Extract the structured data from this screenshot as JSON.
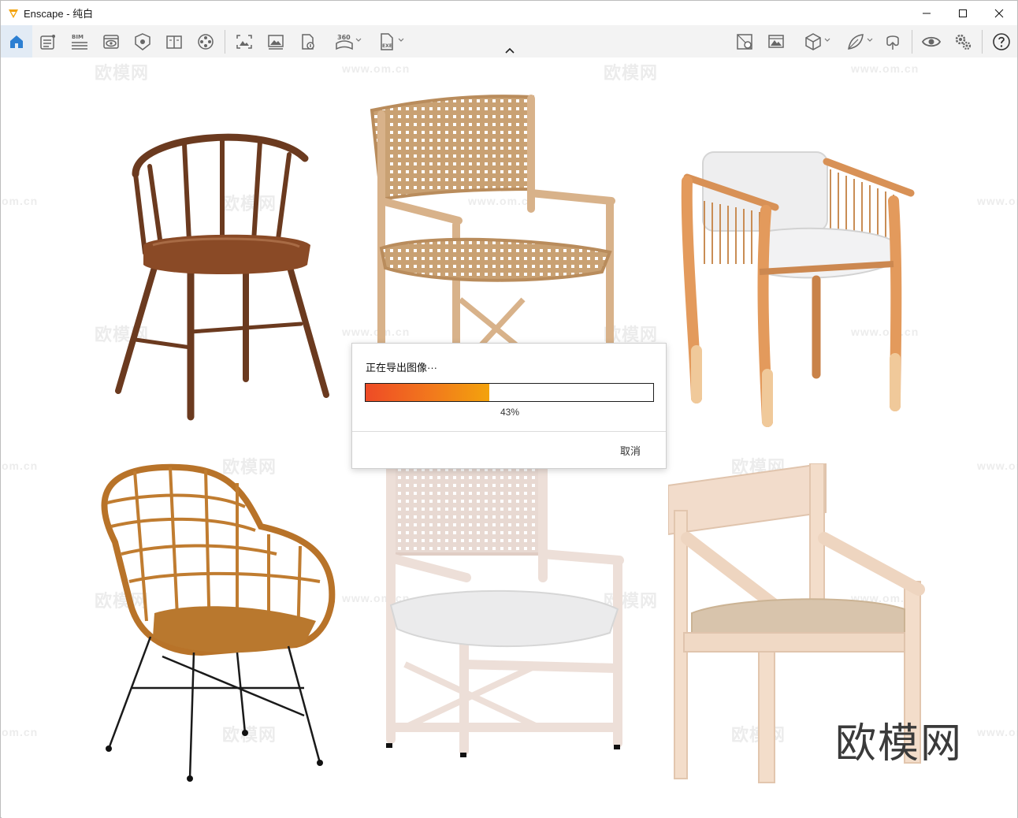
{
  "window": {
    "title": "Enscape - 纯白",
    "accent_color": "#f3a30c"
  },
  "toolbar": {
    "items": [
      {
        "name": "home-icon",
        "active": true
      },
      {
        "name": "asset-library-icon"
      },
      {
        "name": "bim-icon",
        "label": "BIM"
      },
      {
        "name": "view-icon"
      },
      {
        "name": "material-icon"
      },
      {
        "name": "book-icon"
      },
      {
        "name": "film-reel-icon"
      },
      {
        "name": "screenshot-icon"
      },
      {
        "name": "batch-render-icon"
      },
      {
        "name": "upload-icon"
      },
      {
        "name": "panorama-360-icon",
        "label": "360"
      },
      {
        "name": "export-exe-icon",
        "label": "EXE"
      },
      {
        "name": "cube-map-icon"
      },
      {
        "name": "image-gallery-icon"
      },
      {
        "name": "cube-icon"
      },
      {
        "name": "leaf-icon"
      },
      {
        "name": "vr-headset-icon"
      },
      {
        "name": "eye-icon"
      },
      {
        "name": "settings-icon"
      },
      {
        "name": "help-icon"
      }
    ]
  },
  "watermark": {
    "text_cn": "欧模网",
    "text_url": "www.om.cn",
    "text_url_short": "om.cn",
    "brand": "欧模网"
  },
  "dialog": {
    "title": "正在导出图像···",
    "progress_percent": 43,
    "progress_label": "43%",
    "cancel_label": "取消"
  }
}
